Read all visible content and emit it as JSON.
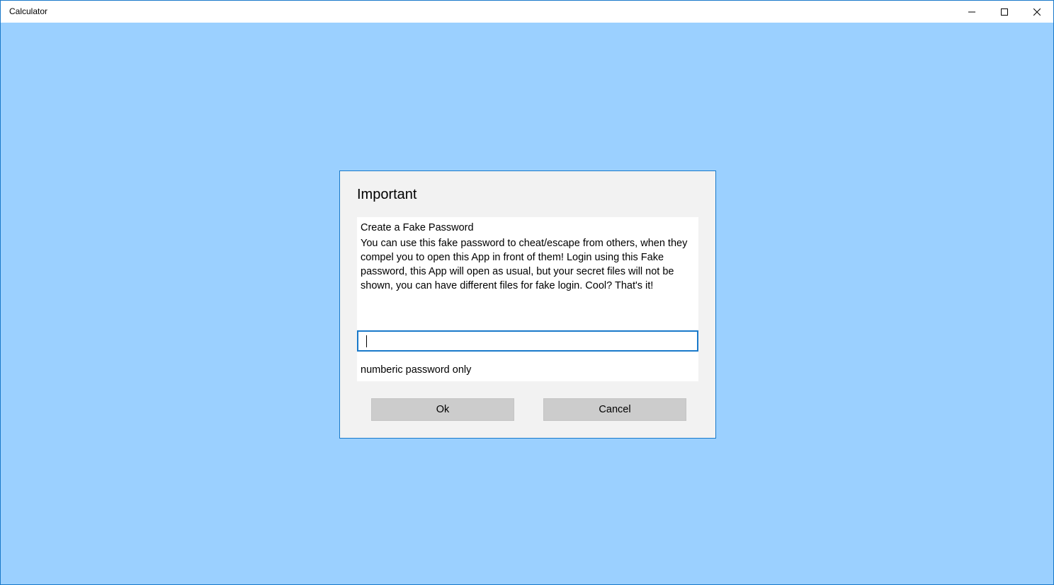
{
  "window": {
    "title": "Calculator",
    "controls": {
      "minimize_icon": "minimize-icon",
      "maximize_icon": "maximize-icon",
      "close_icon": "close-icon"
    }
  },
  "colors": {
    "background": "#9bd0ff",
    "accent": "#1979ca",
    "dialog_background": "#f2f2f2",
    "button_background": "#cccccc"
  },
  "dialog": {
    "title": "Important",
    "heading": "Create a Fake Password",
    "message": "You can use this fake password to cheat/escape from others, when they compel you to open this App in front of them! Login using this Fake password, this App will open as usual, but your secret files will not be shown, you can have different files for fake login. Cool? That's it!",
    "password_value": "",
    "hint": "numberic password only",
    "ok_label": "Ok",
    "cancel_label": "Cancel"
  }
}
